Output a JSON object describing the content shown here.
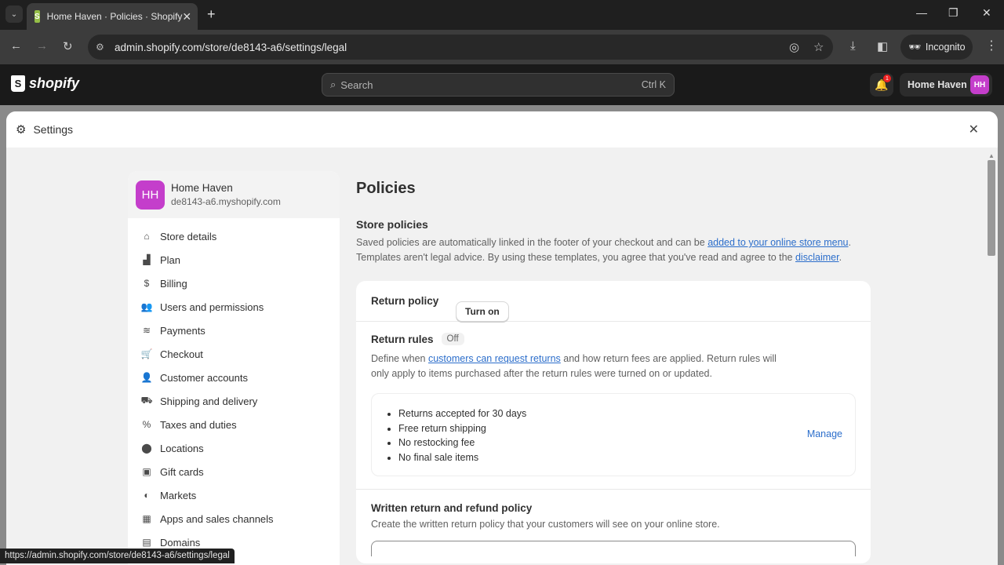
{
  "browser": {
    "tab_title": "Home Haven · Policies · Shopify",
    "url": "admin.shopify.com/store/de8143-a6/settings/legal",
    "incognito_label": "Incognito",
    "status_url": "https://admin.shopify.com/store/de8143-a6/settings/legal"
  },
  "topbar": {
    "logo": "shopify",
    "search_placeholder": "Search",
    "search_shortcut": "Ctrl K",
    "notification_count": "1",
    "store_name": "Home Haven",
    "avatar_initials": "HH"
  },
  "modal": {
    "title": "Settings"
  },
  "sidebar": {
    "store_name": "Home Haven",
    "store_domain": "de8143-a6.myshopify.com",
    "avatar_initials": "HH",
    "items": [
      {
        "label": "Store details",
        "icon": "store-icon"
      },
      {
        "label": "Plan",
        "icon": "plan-icon"
      },
      {
        "label": "Billing",
        "icon": "billing-icon"
      },
      {
        "label": "Users and permissions",
        "icon": "users-icon"
      },
      {
        "label": "Payments",
        "icon": "payments-icon"
      },
      {
        "label": "Checkout",
        "icon": "cart-icon"
      },
      {
        "label": "Customer accounts",
        "icon": "person-icon"
      },
      {
        "label": "Shipping and delivery",
        "icon": "truck-icon"
      },
      {
        "label": "Taxes and duties",
        "icon": "tax-icon"
      },
      {
        "label": "Locations",
        "icon": "location-icon"
      },
      {
        "label": "Gift cards",
        "icon": "gift-card-icon"
      },
      {
        "label": "Markets",
        "icon": "markets-icon"
      },
      {
        "label": "Apps and sales channels",
        "icon": "apps-icon"
      },
      {
        "label": "Domains",
        "icon": "domains-icon"
      }
    ]
  },
  "main": {
    "title": "Policies",
    "store_policies": {
      "title": "Store policies",
      "desc_1": "Saved policies are automatically linked in the footer of your checkout and can be ",
      "link_1": "added to your online store menu",
      "desc_2": ". Templates aren't legal advice. By using these templates, you agree that you've read and agree to the ",
      "link_2": "disclaimer",
      "desc_3": "."
    },
    "return_policy": {
      "title": "Return policy",
      "rules_title": "Return rules",
      "rules_status": "Off",
      "rules_desc_1": "Define when ",
      "rules_link": "customers can request returns",
      "rules_desc_2": " and how return fees are applied. Return rules will only apply to items purchased after the return rules were turned on or updated.",
      "turn_on_label": "Turn on",
      "rules": [
        "Returns accepted for 30 days",
        "Free return shipping",
        "No restocking fee",
        "No final sale items"
      ],
      "manage_label": "Manage",
      "written_title": "Written return and refund policy",
      "written_desc": "Create the written return policy that your customers will see on your online store."
    }
  }
}
